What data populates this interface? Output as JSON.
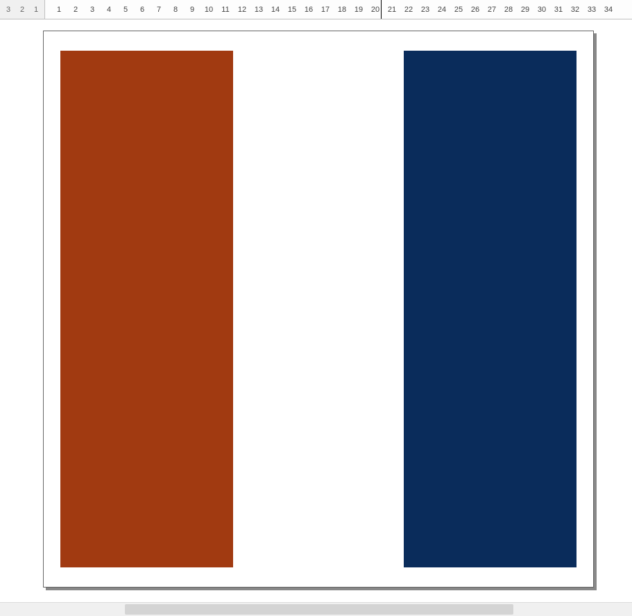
{
  "ruler": {
    "left_margin_units": [
      "3",
      "2",
      "1"
    ],
    "main_units": [
      "1",
      "2",
      "3",
      "4",
      "5",
      "6",
      "7",
      "8",
      "9",
      "10",
      "11",
      "12",
      "13",
      "14",
      "15",
      "16",
      "17",
      "18",
      "19",
      "20",
      "21",
      "22",
      "23",
      "24",
      "25",
      "26",
      "27",
      "28",
      "29",
      "30",
      "31",
      "32",
      "33",
      "34"
    ]
  },
  "artwork": {
    "colors": {
      "left_stripe": "#A13A11",
      "middle_stripe": "#FFFFFF",
      "right_stripe": "#0A2C5B"
    }
  }
}
